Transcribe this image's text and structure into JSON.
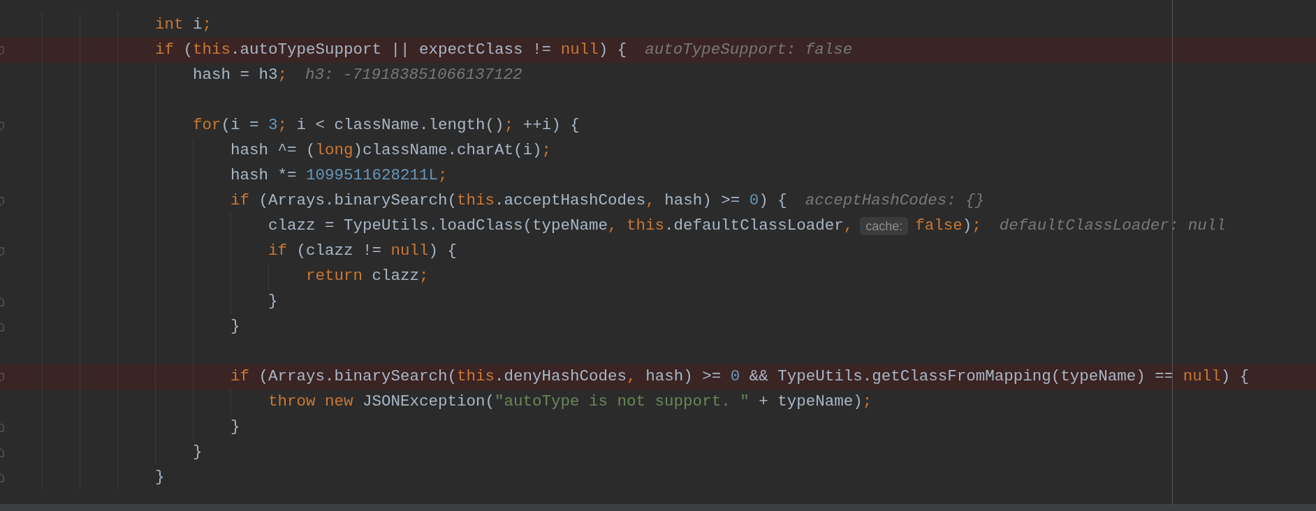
{
  "editor": {
    "lines": [
      {
        "highlighted": false,
        "fold_marker": false,
        "segments": [
          {
            "kind": "code",
            "tokens": [
              {
                "kind": "kw",
                "text": "int"
              },
              {
                "kind": "plain",
                "text": " i"
              },
              {
                "kind": "kw",
                "text": ";"
              }
            ]
          }
        ]
      },
      {
        "highlighted": true,
        "fold_marker": true,
        "segments": [
          {
            "kind": "code",
            "tokens": [
              {
                "kind": "kw",
                "text": "if"
              },
              {
                "kind": "plain",
                "text": " ("
              },
              {
                "kind": "kw",
                "text": "this"
              },
              {
                "kind": "plain",
                "text": ".autoTypeSupport || expectClass != "
              },
              {
                "kind": "kw",
                "text": "null"
              },
              {
                "kind": "plain",
                "text": ") {"
              }
            ]
          },
          {
            "kind": "hint",
            "text": "autoTypeSupport: false"
          }
        ],
        "children": [
          {
            "highlighted": false,
            "fold_marker": false,
            "segments": [
              {
                "kind": "code",
                "tokens": [
                  {
                    "kind": "plain",
                    "text": "hash = h3"
                  },
                  {
                    "kind": "kw",
                    "text": ";"
                  }
                ]
              },
              {
                "kind": "hint",
                "text": "h3: -719183851066137122"
              }
            ]
          },
          {
            "highlighted": false,
            "fold_marker": false
          },
          {
            "highlighted": false,
            "fold_marker": true,
            "segments": [
              {
                "kind": "code",
                "tokens": [
                  {
                    "kind": "kw",
                    "text": "for"
                  },
                  {
                    "kind": "plain",
                    "text": "(i = "
                  },
                  {
                    "kind": "num",
                    "text": "3"
                  },
                  {
                    "kind": "kw",
                    "text": ";"
                  },
                  {
                    "kind": "plain",
                    "text": " i < className.length()"
                  },
                  {
                    "kind": "kw",
                    "text": ";"
                  },
                  {
                    "kind": "plain",
                    "text": " ++i) {"
                  }
                ]
              }
            ],
            "children": [
              {
                "highlighted": false,
                "fold_marker": false,
                "segments": [
                  {
                    "kind": "code",
                    "tokens": [
                      {
                        "kind": "plain",
                        "text": "hash ^= ("
                      },
                      {
                        "kind": "kw",
                        "text": "long"
                      },
                      {
                        "kind": "plain",
                        "text": ")className.charAt(i)"
                      },
                      {
                        "kind": "kw",
                        "text": ";"
                      }
                    ]
                  }
                ]
              },
              {
                "highlighted": false,
                "fold_marker": false,
                "segments": [
                  {
                    "kind": "code",
                    "tokens": [
                      {
                        "kind": "plain",
                        "text": "hash *= "
                      },
                      {
                        "kind": "num",
                        "text": "1099511628211L"
                      },
                      {
                        "kind": "kw",
                        "text": ";"
                      }
                    ]
                  }
                ]
              },
              {
                "highlighted": false,
                "fold_marker": true,
                "segments": [
                  {
                    "kind": "code",
                    "tokens": [
                      {
                        "kind": "kw",
                        "text": "if"
                      },
                      {
                        "kind": "plain",
                        "text": " (Arrays.binarySearch("
                      },
                      {
                        "kind": "kw",
                        "text": "this"
                      },
                      {
                        "kind": "plain",
                        "text": ".acceptHashCodes"
                      },
                      {
                        "kind": "kw",
                        "text": ","
                      },
                      {
                        "kind": "plain",
                        "text": " hash) >= "
                      },
                      {
                        "kind": "num",
                        "text": "0"
                      },
                      {
                        "kind": "plain",
                        "text": ") {"
                      }
                    ]
                  },
                  {
                    "kind": "hint",
                    "text": "acceptHashCodes: {}"
                  }
                ],
                "children": [
                  {
                    "highlighted": false,
                    "fold_marker": false,
                    "segments": [
                      {
                        "kind": "code",
                        "tokens": [
                          {
                            "kind": "plain",
                            "text": "clazz = TypeUtils.loadClass(typeName"
                          },
                          {
                            "kind": "kw",
                            "text": ", this"
                          },
                          {
                            "kind": "plain",
                            "text": ".defaultClassLoader"
                          },
                          {
                            "kind": "kw",
                            "text": ","
                          }
                        ]
                      },
                      {
                        "kind": "param",
                        "text": "cache:"
                      },
                      {
                        "kind": "code",
                        "tokens": [
                          {
                            "kind": "kw",
                            "text": "false"
                          },
                          {
                            "kind": "plain",
                            "text": ")"
                          },
                          {
                            "kind": "kw",
                            "text": ";"
                          }
                        ]
                      },
                      {
                        "kind": "hint",
                        "text": "defaultClassLoader: null"
                      }
                    ]
                  },
                  {
                    "highlighted": false,
                    "fold_marker": true,
                    "segments": [
                      {
                        "kind": "code",
                        "tokens": [
                          {
                            "kind": "kw",
                            "text": "if"
                          },
                          {
                            "kind": "plain",
                            "text": " (clazz != "
                          },
                          {
                            "kind": "kw",
                            "text": "null"
                          },
                          {
                            "kind": "plain",
                            "text": ") {"
                          }
                        ]
                      }
                    ],
                    "children": [
                      {
                        "highlighted": false,
                        "fold_marker": false,
                        "segments": [
                          {
                            "kind": "code",
                            "tokens": [
                              {
                                "kind": "kw",
                                "text": "return"
                              },
                              {
                                "kind": "plain",
                                "text": " clazz"
                              },
                              {
                                "kind": "kw",
                                "text": ";"
                              }
                            ]
                          }
                        ]
                      }
                    ]
                  },
                  {
                    "highlighted": false,
                    "fold_marker": true,
                    "segments": [
                      {
                        "kind": "code",
                        "tokens": [
                          {
                            "kind": "plain",
                            "text": "}"
                          }
                        ]
                      }
                    ]
                  }
                ]
              },
              {
                "highlighted": false,
                "fold_marker": true,
                "segments": [
                  {
                    "kind": "code",
                    "tokens": [
                      {
                        "kind": "plain",
                        "text": "}"
                      }
                    ]
                  }
                ]
              },
              {
                "highlighted": false,
                "fold_marker": false
              },
              {
                "highlighted": true,
                "fold_marker": true,
                "segments": [
                  {
                    "kind": "code",
                    "tokens": [
                      {
                        "kind": "kw",
                        "text": "if"
                      },
                      {
                        "kind": "plain",
                        "text": " (Arrays.binarySearch("
                      },
                      {
                        "kind": "kw",
                        "text": "this"
                      },
                      {
                        "kind": "plain",
                        "text": ".denyHashCodes"
                      },
                      {
                        "kind": "kw",
                        "text": ","
                      },
                      {
                        "kind": "plain",
                        "text": " hash) >= "
                      },
                      {
                        "kind": "num",
                        "text": "0"
                      },
                      {
                        "kind": "plain",
                        "text": " && TypeUtils.getClassFromMapping(typeName) == "
                      },
                      {
                        "kind": "kw",
                        "text": "null"
                      },
                      {
                        "kind": "plain",
                        "text": ") {"
                      }
                    ]
                  }
                ],
                "children": [
                  {
                    "highlighted": false,
                    "fold_marker": false,
                    "segments": [
                      {
                        "kind": "code",
                        "tokens": [
                          {
                            "kind": "kw",
                            "text": "throw new"
                          },
                          {
                            "kind": "plain",
                            "text": " JSONException("
                          },
                          {
                            "kind": "str",
                            "text": "\"autoType is not support. \""
                          },
                          {
                            "kind": "plain",
                            "text": " + typeName)"
                          },
                          {
                            "kind": "kw",
                            "text": ";"
                          }
                        ]
                      }
                    ]
                  }
                ]
              },
              {
                "highlighted": false,
                "fold_marker": true,
                "segments": [
                  {
                    "kind": "code",
                    "tokens": [
                      {
                        "kind": "plain",
                        "text": "}"
                      }
                    ]
                  }
                ]
              }
            ]
          },
          {
            "highlighted": false,
            "fold_marker": true,
            "segments": [
              {
                "kind": "code",
                "tokens": [
                  {
                    "kind": "plain",
                    "text": "}"
                  }
                ]
              }
            ]
          }
        ]
      },
      {
        "highlighted": false,
        "fold_marker": true,
        "segments": [
          {
            "kind": "code",
            "tokens": [
              {
                "kind": "plain",
                "text": "}"
              }
            ]
          }
        ]
      }
    ]
  }
}
